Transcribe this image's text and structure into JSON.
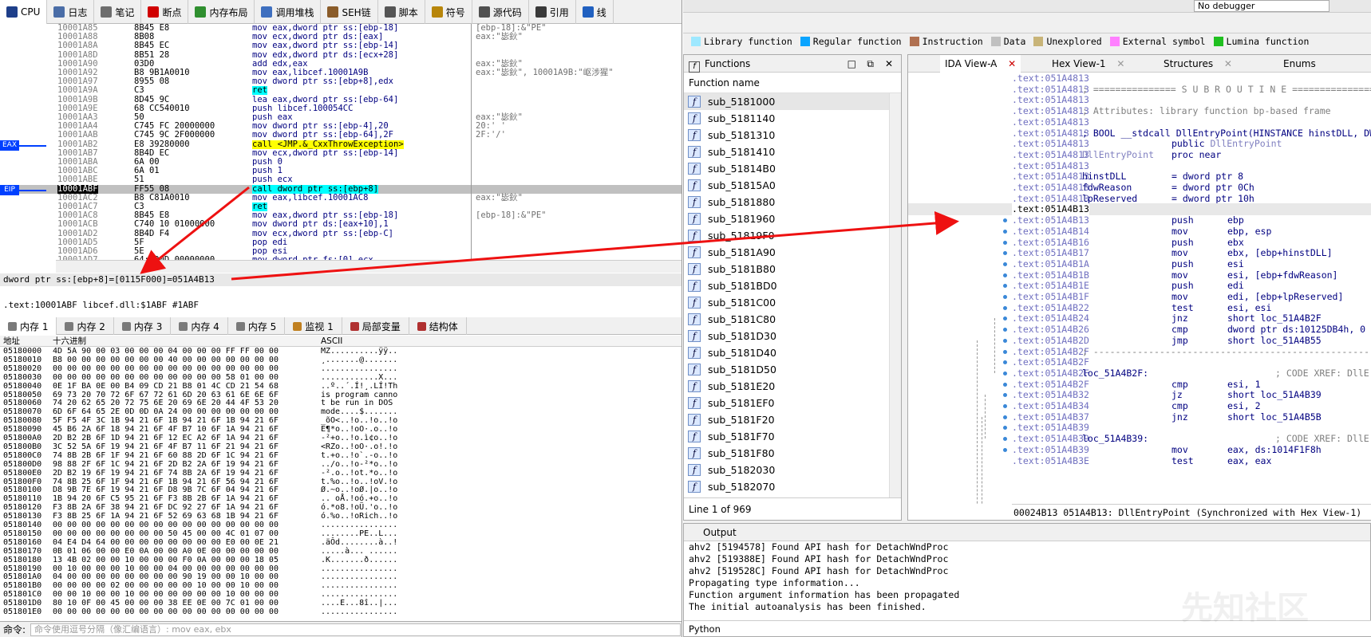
{
  "x64dbg": {
    "tabs": [
      {
        "label": "CPU",
        "color": "#1e3f8a"
      },
      {
        "label": "日志",
        "color": "#4a6da7"
      },
      {
        "label": "笔记",
        "color": "#6d6d6d"
      },
      {
        "label": "断点",
        "color": "#d00000"
      },
      {
        "label": "内存布局",
        "color": "#2f8f2f"
      },
      {
        "label": "调用堆栈",
        "color": "#3e6fbf"
      },
      {
        "label": "SEH链",
        "color": "#8a5c2a"
      },
      {
        "label": "脚本",
        "color": "#555555"
      },
      {
        "label": "符号",
        "color": "#b8860b"
      },
      {
        "label": "源代码",
        "color": "#505050"
      },
      {
        "label": "引用",
        "color": "#3a3a3a"
      },
      {
        "label": "线",
        "color": "#2060c0"
      }
    ],
    "disasm": [
      {
        "addr": "10001A85",
        "bytes": "8B45 E8",
        "instr": "mov eax,dword ptr ss:[ebp-18]",
        "cmt": "[ebp-18]:&\"PE\""
      },
      {
        "addr": "10001A88",
        "bytes": "8B08",
        "instr": "mov ecx,dword ptr ds:[eax]",
        "cmt": "eax:\"毖鈥\""
      },
      {
        "addr": "10001A8A",
        "bytes": "8B45 EC",
        "instr": "mov eax,dword ptr ss:[ebp-14]",
        "cmt": ""
      },
      {
        "addr": "10001A8D",
        "bytes": "8B51 28",
        "instr": "mov edx,dword ptr ds:[ecx+28]",
        "cmt": ""
      },
      {
        "addr": "10001A90",
        "bytes": "03D0",
        "instr": "add edx,eax",
        "cmt": "eax:\"毖鈥\""
      },
      {
        "addr": "10001A92",
        "bytes": "B8 9B1A0010",
        "instr": "mov eax,libcef.10001A9B",
        "cmt": "eax:\"毖鈥\", 10001A9B:\"岖涉猩\""
      },
      {
        "addr": "10001A97",
        "bytes": "8955 08",
        "instr": "mov dword ptr ss:[ebp+8],edx",
        "cmt": ""
      },
      {
        "addr": "10001A9A",
        "bytes": "C3",
        "instr": "ret",
        "cmt": ""
      },
      {
        "addr": "10001A9B",
        "bytes": "8D45 9C",
        "instr": "lea eax,dword ptr ss:[ebp-64]",
        "cmt": ""
      },
      {
        "addr": "10001A9E",
        "bytes": "68 CC540010",
        "instr": "push libcef.100054CC",
        "cmt": ""
      },
      {
        "addr": "10001AA3",
        "bytes": "50",
        "instr": "push eax",
        "cmt": "eax:\"毖鈥\""
      },
      {
        "addr": "10001AA4",
        "bytes": "C745 FC 20000000",
        "instr": "mov dword ptr ss:[ebp-4],20",
        "cmt": "20:' '"
      },
      {
        "addr": "10001AAB",
        "bytes": "C745 9C 2F000000",
        "instr": "mov dword ptr ss:[ebp-64],2F",
        "cmt": "2F:'/'"
      },
      {
        "addr": "10001AB2",
        "bytes": "E8 39280000",
        "instr": "call <JMP.&_CxxThrowException>",
        "cmt": ""
      },
      {
        "addr": "10001AB7",
        "bytes": "8B4D EC",
        "instr": "mov ecx,dword ptr ss:[ebp-14]",
        "cmt": ""
      },
      {
        "addr": "10001ABA",
        "bytes": "6A 00",
        "instr": "push 0",
        "cmt": ""
      },
      {
        "addr": "10001ABC",
        "bytes": "6A 01",
        "instr": "push 1",
        "cmt": ""
      },
      {
        "addr": "10001ABE",
        "bytes": "51",
        "instr": "push ecx",
        "cmt": ""
      },
      {
        "addr": "10001ABF",
        "bytes": "FF55 08",
        "instr": "call dword ptr ss:[ebp+8]",
        "cmt": ""
      },
      {
        "addr": "10001AC2",
        "bytes": "B8 C81A0010",
        "instr": "mov eax,libcef.10001AC8",
        "cmt": "eax:\"毖鈥\""
      },
      {
        "addr": "10001AC7",
        "bytes": "C3",
        "instr": "ret",
        "cmt": ""
      },
      {
        "addr": "10001AC8",
        "bytes": "8B45 E8",
        "instr": "mov eax,dword ptr ss:[ebp-18]",
        "cmt": "[ebp-18]:&\"PE\""
      },
      {
        "addr": "10001ACB",
        "bytes": "C740 10 01000000",
        "instr": "mov dword ptr ds:[eax+10],1",
        "cmt": ""
      },
      {
        "addr": "10001AD2",
        "bytes": "8B4D F4",
        "instr": "mov ecx,dword ptr ss:[ebp-C]",
        "cmt": ""
      },
      {
        "addr": "10001AD5",
        "bytes": "5F",
        "instr": "pop edi",
        "cmt": ""
      },
      {
        "addr": "10001AD6",
        "bytes": "5E",
        "instr": "pop esi",
        "cmt": ""
      },
      {
        "addr": "10001AD7",
        "bytes": "64:890D 00000000",
        "instr": "mov dword ptr fs:[0],ecx",
        "cmt": ""
      }
    ],
    "eax_label": "EAX",
    "eip_label": "EIP",
    "info_line": "dword ptr ss:[ebp+8]=[0115F000]=051A4B13",
    "location_line": ".text:10001ABF libcef.dll:$1ABF #1ABF",
    "mem_tabs": [
      "内存 1",
      "内存 2",
      "内存 3",
      "内存 4",
      "内存 5",
      "监视 1",
      "局部变量",
      "结构体"
    ],
    "mem_header": {
      "addr": "地址",
      "hex": "十六进制",
      "ascii": "ASCII"
    },
    "mem_rows": [
      {
        "a": "05180000",
        "h": "4D 5A 90 00 03 00 00 00 04 00 00 00 FF FF 00 00",
        "x": "MZ..........ÿÿ.."
      },
      {
        "a": "05180010",
        "h": "B8 00 00 00 00 00 00 00 40 00 00 00 00 00 00 00",
        "x": "¸.......@......."
      },
      {
        "a": "05180020",
        "h": "00 00 00 00 00 00 00 00 00 00 00 00 00 00 00 00",
        "x": "................"
      },
      {
        "a": "05180030",
        "h": "00 00 00 00 00 00 00 00 00 00 00 00 58 01 00 00",
        "x": "............X..."
      },
      {
        "a": "05180040",
        "h": "0E 1F BA 0E 00 B4 09 CD 21 B8 01 4C CD 21 54 68",
        "x": "..º..´.Í!¸.LÍ!Th"
      },
      {
        "a": "05180050",
        "h": "69 73 20 70 72 6F 67 72 61 6D 20 63 61 6E 6E 6F",
        "x": "is program canno"
      },
      {
        "a": "05180060",
        "h": "74 20 62 65 20 72 75 6E 20 69 6E 20 44 4F 53 20",
        "x": "t be run in DOS "
      },
      {
        "a": "05180070",
        "h": "6D 6F 64 65 2E 0D 0D 0A 24 00 00 00 00 00 00 00",
        "x": "mode....$......."
      },
      {
        "a": "05180080",
        "h": "5F F5 4F 3C 1B 94 21 6F 1B 94 21 6F 1B 94 21 6F",
        "x": "_õO<..!o..!o..!o"
      },
      {
        "a": "05180090",
        "h": "45 B6 2A 6F 18 94 21 6F 4F B7 10 6F 1A 94 21 6F",
        "x": "E¶*o..!oO·.o..!o"
      },
      {
        "a": "051800A0",
        "h": "2D B2 2B 6F 1D 94 21 6F 12 EC A2 6F 1A 94 21 6F",
        "x": "-²+o..!o.ì¢o..!o"
      },
      {
        "a": "051800B0",
        "h": "3C 52 5A 6F 19 94 21 6F 4F B7 11 6F 21 94 21 6F",
        "x": "<RZo..!oO·.o!.!o"
      },
      {
        "a": "051800C0",
        "h": "74 8B 2B 6F 1F 94 21 6F 60 88 2D 6F 1C 94 21 6F",
        "x": "t.+o..!o`.-o..!o"
      },
      {
        "a": "051800D0",
        "h": "98 88 2F 6F 1C 94 21 6F 2D B2 2A 6F 19 94 21 6F",
        "x": "../o..!o-²*o..!o"
      },
      {
        "a": "051800E0",
        "h": "2D B2 19 6F 19 94 21 6F 74 8B 2A 6F 19 94 21 6F",
        "x": "-².o..!ot.*o..!o"
      },
      {
        "a": "051800F0",
        "h": "74 8B 25 6F 1F 94 21 6F 1B 94 21 6F 56 94 21 6F",
        "x": "t.%o..!o..!oV.!o"
      },
      {
        "a": "05180100",
        "h": "D8 9B 7E 6F 19 94 21 6F D8 9B 7C 6F 04 94 21 6F",
        "x": "Ø.~o..!oØ.|o..!o"
      },
      {
        "a": "05180110",
        "h": "1B 94 20 6F C5 95 21 6F F3 8B 2B 6F 1A 94 21 6F",
        "x": ".. oÅ.!oó.+o..!o"
      },
      {
        "a": "05180120",
        "h": "F3 8B 2A 6F 38 94 21 6F DC 92 27 6F 1A 94 21 6F",
        "x": "ó.*o8.!oÜ.'o..!o"
      },
      {
        "a": "05180130",
        "h": "F3 8B 25 6F 1A 94 21 6F 52 69 63 68 1B 94 21 6F",
        "x": "ó.%o..!oRich..!o"
      },
      {
        "a": "05180140",
        "h": "00 00 00 00 00 00 00 00 00 00 00 00 00 00 00 00",
        "x": "................"
      },
      {
        "a": "05180150",
        "h": "00 00 00 00 00 00 00 00 50 45 00 00 4C 01 07 00",
        "x": "........PE..L..."
      },
      {
        "a": "05180160",
        "h": "04 E4 D4 64 00 00 00 00 00 00 00 00 E0 00 0E 21",
        "x": ".äÔd........à..!"
      },
      {
        "a": "05180170",
        "h": "0B 01 06 00 00 E0 0A 00 00 A0 0E 00 00 00 00 00",
        "x": ".....à... ......"
      },
      {
        "a": "05180180",
        "h": "13 4B 02 00 00 10 00 00 00 F0 0A 00 00 00 18 05",
        "x": ".K.......ð......"
      },
      {
        "a": "05180190",
        "h": "00 10 00 00 00 10 00 00 04 00 00 00 00 00 00 00",
        "x": "................"
      },
      {
        "a": "051801A0",
        "h": "04 00 00 00 00 00 00 00 00 90 19 00 00 10 00 00",
        "x": "................"
      },
      {
        "a": "051801B0",
        "h": "00 00 00 00 02 00 00 00 00 00 10 00 00 10 00 00",
        "x": "................"
      },
      {
        "a": "051801C0",
        "h": "00 00 10 00 00 10 00 00 00 00 00 00 10 00 00 00",
        "x": "................"
      },
      {
        "a": "051801D0",
        "h": "80 10 0F 00 45 00 00 00 38 EE 0E 00 7C 01 00 00",
        "x": "....E...8î..|..."
      },
      {
        "a": "051801E0",
        "h": "00 00 00 00 00 00 00 00 00 00 00 00 00 00 00 00",
        "x": "................"
      }
    ],
    "cmd_label": "命令:",
    "cmd_placeholder": "命令使用逗号分隔（像汇编语言）: mov eax, ebx"
  },
  "ida": {
    "debugger_select": "No debugger",
    "legend": [
      {
        "label": "Library function",
        "color": "#9ee8ff"
      },
      {
        "label": "Regular function",
        "color": "#0aa4ff"
      },
      {
        "label": "Instruction",
        "color": "#b07050"
      },
      {
        "label": "Data",
        "color": "#c0c0c0"
      },
      {
        "label": "Unexplored",
        "color": "#c8b478"
      },
      {
        "label": "External symbol",
        "color": "#ff80ff"
      },
      {
        "label": "Lumina function",
        "color": "#20c020"
      }
    ],
    "functions_title": "Functions",
    "functions_col": "Function name",
    "functions": [
      "sub_5181000",
      "sub_5181140",
      "sub_5181310",
      "sub_5181410",
      "sub_51814B0",
      "sub_51815A0",
      "sub_5181880",
      "sub_5181960",
      "sub_51819F0",
      "sub_5181A90",
      "sub_5181B80",
      "sub_5181BD0",
      "sub_5181C00",
      "sub_5181C80",
      "sub_5181D30",
      "sub_5181D40",
      "sub_5181D50",
      "sub_5181E20",
      "sub_5181EF0",
      "sub_5181F20",
      "sub_5181F70",
      "sub_5181F80",
      "sub_5182030",
      "sub_5182070"
    ],
    "functions_status": "Line 1 of 969",
    "view_tabs": [
      "IDA View-A",
      "Hex View-1",
      "Structures",
      "Enums"
    ],
    "listing": [
      {
        "a": ".text:051A4813",
        "t": "blank"
      },
      {
        "a": ".text:051A4813",
        "t": "cmt",
        "c": "; =============== S U B R O U T I N E ======================================="
      },
      {
        "a": ".text:051A4813",
        "t": "blank"
      },
      {
        "a": ".text:051A4813",
        "t": "cmt",
        "c": "; Attributes: library function bp-based frame"
      },
      {
        "a": ".text:051A4813",
        "t": "blank"
      },
      {
        "a": ".text:051A4813",
        "t": "lbl",
        "c": "; BOOL __stdcall DllEntryPoint(HINSTANCE hinstDLL, DWORD fdwReason"
      },
      {
        "a": ".text:051A4813",
        "t": "op",
        "m": "public DllEntryPoint",
        "o": ""
      },
      {
        "a": ".text:051A4813",
        "t": "def",
        "c": "DllEntryPoint",
        "m": "proc near",
        "o": ""
      },
      {
        "a": ".text:051A4813",
        "t": "blank"
      },
      {
        "a": ".text:051A4813",
        "t": "def",
        "c": "hinstDLL",
        "m": "= dword ptr  8",
        "o": ""
      },
      {
        "a": ".text:051A4813",
        "t": "def",
        "c": "fdwReason",
        "m": "= dword ptr  0Ch",
        "o": ""
      },
      {
        "a": ".text:051A4813",
        "t": "def",
        "c": "lpReserved",
        "m": "= dword ptr  10h",
        "o": ""
      },
      {
        "a": ".text:051A4B13",
        "t": "cur"
      },
      {
        "a": ".text:051A4B13",
        "t": "op",
        "m": "push",
        "o": "ebp"
      },
      {
        "a": ".text:051A4B14",
        "t": "op",
        "m": "mov",
        "o": "ebp, esp"
      },
      {
        "a": ".text:051A4B16",
        "t": "op",
        "m": "push",
        "o": "ebx"
      },
      {
        "a": ".text:051A4B17",
        "t": "op",
        "m": "mov",
        "o": "ebx, [ebp+hinstDLL]"
      },
      {
        "a": ".text:051A4B1A",
        "t": "op",
        "m": "push",
        "o": "esi"
      },
      {
        "a": ".text:051A4B1B",
        "t": "op",
        "m": "mov",
        "o": "esi, [ebp+fdwReason]"
      },
      {
        "a": ".text:051A4B1E",
        "t": "op",
        "m": "push",
        "o": "edi"
      },
      {
        "a": ".text:051A4B1F",
        "t": "op",
        "m": "mov",
        "o": "edi, [ebp+lpReserved]"
      },
      {
        "a": ".text:051A4B22",
        "t": "op",
        "m": "test",
        "o": "esi, esi"
      },
      {
        "a": ".text:051A4B24",
        "t": "op",
        "m": "jnz",
        "o": "short loc_51A4B2F"
      },
      {
        "a": ".text:051A4B26",
        "t": "op",
        "m": "cmp",
        "o": "dword ptr ds:10125DB4h, 0"
      },
      {
        "a": ".text:051A4B2D",
        "t": "op",
        "m": "jmp",
        "o": "short loc_51A4B55"
      },
      {
        "a": ".text:051A4B2F",
        "t": "cmt",
        "c": "; ---------------------------------------------------------------------------"
      },
      {
        "a": ".text:051A4B2F",
        "t": "blank"
      },
      {
        "a": ".text:051A4B2F",
        "t": "xref",
        "c": "loc_51A4B2F:",
        "x": "; CODE XREF: DllE"
      },
      {
        "a": ".text:051A4B2F",
        "t": "op",
        "m": "cmp",
        "o": "esi, 1"
      },
      {
        "a": ".text:051A4B32",
        "t": "op",
        "m": "jz",
        "o": "short loc_51A4B39"
      },
      {
        "a": ".text:051A4B34",
        "t": "op",
        "m": "cmp",
        "o": "esi, 2"
      },
      {
        "a": ".text:051A4B37",
        "t": "op",
        "m": "jnz",
        "o": "short loc_51A4B5B"
      },
      {
        "a": ".text:051A4B39",
        "t": "blank"
      },
      {
        "a": ".text:051A4B39",
        "t": "xref",
        "c": "loc_51A4B39:",
        "x": "; CODE XREF: DllE"
      },
      {
        "a": ".text:051A4B39",
        "t": "op",
        "m": "mov",
        "o": "eax, ds:1014F1F8h"
      },
      {
        "a": ".text:051A4B3E",
        "t": "op",
        "m": "test",
        "o": "eax, eax"
      }
    ],
    "view_status": "00024B13  051A4B13: DllEntryPoint  (Synchronized with Hex View-1)",
    "output_title": "Output",
    "output_lines": [
      "ahv2 [5194578] Found API hash for DetachWndProc",
      "ahv2 [519388E] Found API hash for DetachWndProc",
      "ahv2 [519528C] Found API hash for DetachWndProc",
      "Propagating type information...",
      "Function argument information has been propagated",
      "The initial autoanalysis has been finished."
    ],
    "python_label": "Python"
  },
  "watermark": "先知社区"
}
